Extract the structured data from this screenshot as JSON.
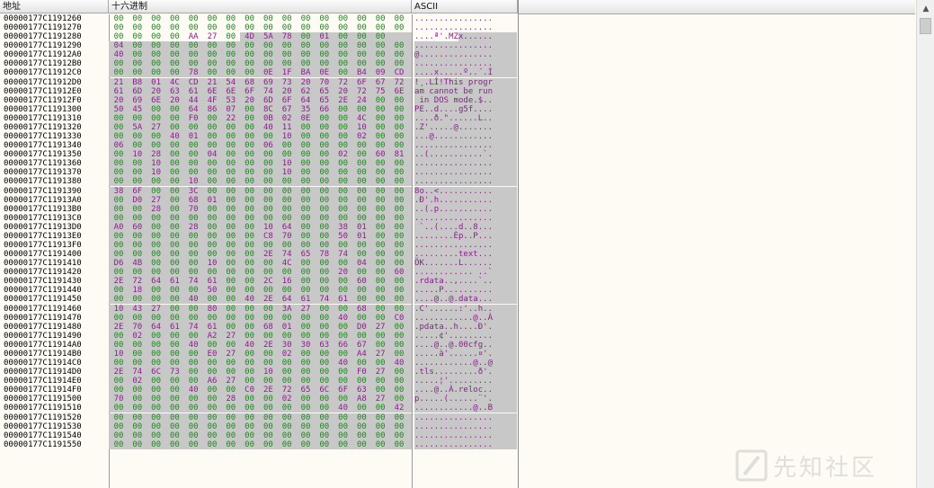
{
  "headers": {
    "address": "地址",
    "hex": "十六进制",
    "ascii": "ASCII"
  },
  "scrollbar": {
    "up_icon": "arrow-up-icon"
  },
  "watermark": {
    "text": "先知社区",
    "icon": "xianzhi-logo-icon"
  },
  "colors": {
    "zero_byte": "#1b8a1b",
    "nonzero_byte": "#8b1d8b",
    "selection": "#c8c8c8"
  },
  "rows": [
    {
      "addr": "00000177C1191260",
      "hex": "00 00 00 00 00 00 00 00 00 00 00 00 00 00 00 00",
      "ascii": "................"
    },
    {
      "addr": "00000177C1191270",
      "hex": "00 00 00 00 00 00 00 00 00 00 00 00 00 00 00 00",
      "ascii": "................"
    },
    {
      "addr": "00000177C1191280",
      "hex": "00 00 00 00 AA 27 00 4D 5A 78 00 01 00 00 00",
      "ascii": "....ª'.MZx......"
    },
    {
      "addr": "00000177C1191290",
      "hex": "04 00 00 00 00 00 00 00 00 00 00 00 00 00 00 00",
      "ascii": "................"
    },
    {
      "addr": "00000177C11912A0",
      "hex": "40 00 00 00 00 00 00 00 00 00 00 00 00 00 00 00",
      "ascii": "@..............."
    },
    {
      "addr": "00000177C11912B0",
      "hex": "00 00 00 00 00 00 00 00 00 00 00 00 00 00 00 00",
      "ascii": "................"
    },
    {
      "addr": "00000177C11912C0",
      "hex": "00 00 00 00 78 00 00 00 0E 1F BA 0E 00 B4 09 CD",
      "ascii": "....x.....º..´.Í"
    },
    {
      "addr": "00000177C11912D0",
      "hex": "21 B8 01 4C CD 21 54 68 69 73 20 70 72 6F 67 72",
      "ascii": "!¸.LÍ!This progr"
    },
    {
      "addr": "00000177C11912E0",
      "hex": "61 6D 20 63 61 6E 6E 6F 74 20 62 65 20 72 75 6E",
      "ascii": "am cannot be run"
    },
    {
      "addr": "00000177C11912F0",
      "hex": "20 69 6E 20 44 4F 53 20 6D 6F 64 65 2E 24 00 00",
      "ascii": " in DOS mode.$.."
    },
    {
      "addr": "00000177C1191300",
      "hex": "50 45 00 00 64 86 07 00 8C 67 35 66 00 00 00 00",
      "ascii": "PE..d....g5f...."
    },
    {
      "addr": "00000177C1191310",
      "hex": "00 00 00 00 F0 00 22 00 0B 02 0E 00 00 4C 00 00",
      "ascii": "....ð.\"......L.."
    },
    {
      "addr": "00000177C1191320",
      "hex": "00 5A 27 00 00 00 00 00 40 11 00 00 00 10 00 00",
      "ascii": ".Z'.....@......."
    },
    {
      "addr": "00000177C1191330",
      "hex": "00 00 00 40 01 00 00 00 00 10 00 00 00 02 00 00",
      "ascii": "...@............"
    },
    {
      "addr": "00000177C1191340",
      "hex": "06 00 00 00 00 00 00 00 06 00 00 00 00 00 00 00",
      "ascii": "................"
    },
    {
      "addr": "00000177C1191350",
      "hex": "00 10 28 00 00 04 00 00 00 00 00 00 02 00 60 81",
      "ascii": "..(...........`."
    },
    {
      "addr": "00000177C1191360",
      "hex": "00 00 10 00 00 00 00 00 00 10 00 00 00 00 00 00",
      "ascii": "................"
    },
    {
      "addr": "00000177C1191370",
      "hex": "00 00 10 00 00 00 00 00 00 10 00 00 00 00 00 00",
      "ascii": "................"
    },
    {
      "addr": "00000177C1191380",
      "hex": "00 00 00 00 10 00 00 00 00 00 00 00 00 00 00 00",
      "ascii": "................"
    },
    {
      "addr": "00000177C1191390",
      "hex": "38 6F 00 00 3C 00 00 00 00 00 00 00 00 00 00 00",
      "ascii": "8o..<..........."
    },
    {
      "addr": "00000177C11913A0",
      "hex": "00 D0 27 00 68 01 00 00 00 00 00 00 00 00 00 00",
      "ascii": ".Ð'.h..........."
    },
    {
      "addr": "00000177C11913B0",
      "hex": "00 00 28 00 70 00 00 00 00 00 00 00 00 00 00 00",
      "ascii": "..(.p..........."
    },
    {
      "addr": "00000177C11913C0",
      "hex": "00 00 00 00 00 00 00 00 00 00 00 00 00 00 00 00",
      "ascii": "................"
    },
    {
      "addr": "00000177C11913D0",
      "hex": "A0 60 00 00 28 00 00 00 10 64 00 00 38 01 00 00",
      "ascii": " `..(....d..8..."
    },
    {
      "addr": "00000177C11913E0",
      "hex": "00 00 00 00 00 00 00 00 C8 70 00 00 50 01 00 00",
      "ascii": "........Èp..P..."
    },
    {
      "addr": "00000177C11913F0",
      "hex": "00 00 00 00 00 00 00 00 00 00 00 00 00 00 00 00",
      "ascii": "................"
    },
    {
      "addr": "00000177C1191400",
      "hex": "00 00 00 00 00 00 00 00 2E 74 65 78 74 00 00 00",
      "ascii": ".........text..."
    },
    {
      "addr": "00000177C1191410",
      "hex": "D6 4B 00 00 00 10 00 00 00 4C 00 00 00 04 00 00",
      "ascii": "ÖK.......L......"
    },
    {
      "addr": "00000177C1191420",
      "hex": "00 00 00 00 00 00 00 00 00 00 00 00 20 00 00 60",
      "ascii": "............ ..`"
    },
    {
      "addr": "00000177C1191430",
      "hex": "2E 72 64 61 74 61 00 00 2C 16 00 00 00 60 00 00",
      "ascii": ".rdata..,....`.."
    },
    {
      "addr": "00000177C1191440",
      "hex": "00 18 00 00 00 50 00 00 00 00 00 00 00 00 00 00",
      "ascii": ".....P.........."
    },
    {
      "addr": "00000177C1191450",
      "hex": "00 00 00 00 40 00 00 40 2E 64 61 74 61 00 00 00",
      "ascii": "....@..@.data..."
    },
    {
      "addr": "00000177C1191460",
      "hex": "10 43 27 00 00 80 00 00 00 3A 27 00 00 68 00 00",
      "ascii": ".C'......:'..h.."
    },
    {
      "addr": "00000177C1191470",
      "hex": "00 00 00 00 00 00 00 00 00 00 00 00 40 00 00 C0",
      "ascii": "............@..À"
    },
    {
      "addr": "00000177C1191480",
      "hex": "2E 70 64 61 74 61 00 00 68 01 00 00 00 D0 27 00",
      "ascii": ".pdata..h....Ð'."
    },
    {
      "addr": "00000177C1191490",
      "hex": "00 02 00 00 00 A2 27 00 00 00 00 00 00 00 00 00",
      "ascii": ".....¢'........."
    },
    {
      "addr": "00000177C11914A0",
      "hex": "00 00 00 00 40 00 00 40 2E 30 30 63 66 67 00 00",
      "ascii": "....@..@.00cfg.."
    },
    {
      "addr": "00000177C11914B0",
      "hex": "10 00 00 00 00 E0 27 00 00 02 00 00 00 A4 27 00",
      "ascii": ".....à'......¤'."
    },
    {
      "addr": "00000177C11914C0",
      "hex": "00 00 00 00 00 00 00 00 00 00 00 00 40 00 00 40",
      "ascii": "............@..@"
    },
    {
      "addr": "00000177C11914D0",
      "hex": "2E 74 6C 73 00 00 00 00 10 00 00 00 00 F0 27 00",
      "ascii": ".tls.........ð'."
    },
    {
      "addr": "00000177C11914E0",
      "hex": "00 02 00 00 00 A6 27 00 00 00 00 00 00 00 00 00",
      "ascii": ".....¦'........."
    },
    {
      "addr": "00000177C11914F0",
      "hex": "00 00 00 00 40 00 00 C0 2E 72 65 6C 6F 63 00 00",
      "ascii": "....@..À.reloc.."
    },
    {
      "addr": "00000177C1191500",
      "hex": "70 00 00 00 00 00 28 00 00 02 00 00 00 A8 27 00",
      "ascii": "p.....(......¨'."
    },
    {
      "addr": "00000177C1191510",
      "hex": "00 00 00 00 00 00 00 00 00 00 00 00 40 00 00 42",
      "ascii": "............@..B"
    },
    {
      "addr": "00000177C1191520",
      "hex": "00 00 00 00 00 00 00 00 00 00 00 00 00 00 00 00",
      "ascii": "................"
    },
    {
      "addr": "00000177C1191530",
      "hex": "00 00 00 00 00 00 00 00 00 00 00 00 00 00 00 00",
      "ascii": "................"
    },
    {
      "addr": "00000177C1191540",
      "hex": "00 00 00 00 00 00 00 00 00 00 00 00 00 00 00 00",
      "ascii": "................"
    },
    {
      "addr": "00000177C1191550",
      "hex": "00 00 00 00 00 00 00 00 00 00 00 00 00 00 00 00",
      "ascii": "................"
    }
  ]
}
